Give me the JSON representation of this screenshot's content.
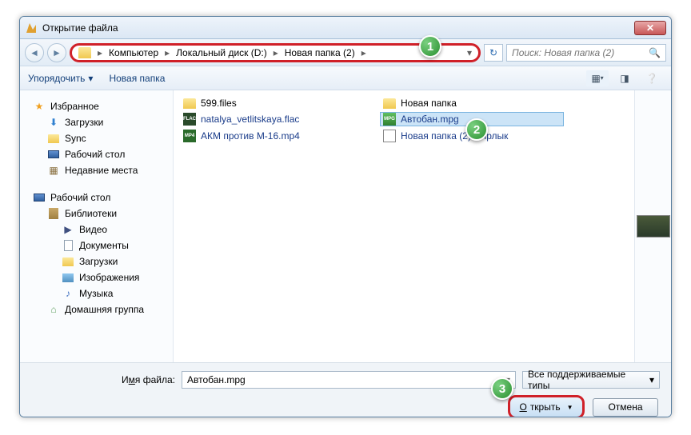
{
  "window": {
    "title": "Открытие файла"
  },
  "breadcrumb": {
    "segs": [
      "Компьютер",
      "Локальный диск (D:)",
      "Новая папка (2)"
    ]
  },
  "search": {
    "placeholder": "Поиск: Новая папка (2)"
  },
  "toolbar": {
    "organize": "Упорядочить",
    "newfolder": "Новая папка"
  },
  "tree": {
    "fav": "Избранное",
    "downloads": "Загрузки",
    "sync": "Sync",
    "desktop": "Рабочий стол",
    "recent": "Недавние места",
    "desktop2": "Рабочий стол",
    "libraries": "Библиотеки",
    "video": "Видео",
    "documents": "Документы",
    "downloads2": "Загрузки",
    "pictures": "Изображения",
    "music": "Музыка",
    "homegroup": "Домашняя группа"
  },
  "files": {
    "col1": [
      {
        "name": "599.files",
        "type": "folder"
      },
      {
        "name": "natalya_vetlitskaya.flac",
        "type": "flac"
      },
      {
        "name": "АКМ против М-16.mp4",
        "type": "mp4"
      }
    ],
    "col2": [
      {
        "name": "Новая папка",
        "type": "folder"
      },
      {
        "name": "Автобан.mpg",
        "type": "mpg",
        "selected": true
      },
      {
        "name": "Новая папка (2) - Ярлык",
        "type": "shortcut"
      }
    ]
  },
  "footer": {
    "filename_label_pre": "И",
    "filename_label_u": "м",
    "filename_label_post": "я файла:",
    "filename_value": "Автобан.mpg",
    "filetype": "Все поддерживаемые типы",
    "open_u": "О",
    "open_post": "ткрыть",
    "cancel": "Отмена"
  },
  "callouts": {
    "c1": "1",
    "c2": "2",
    "c3": "3"
  }
}
